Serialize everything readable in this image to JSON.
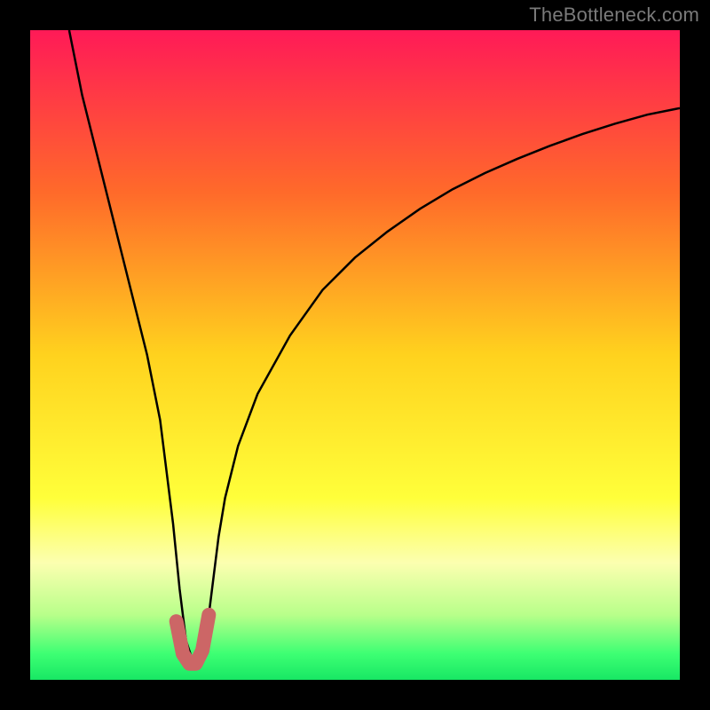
{
  "watermark": "TheBottleneck.com",
  "chart_data": {
    "type": "line",
    "title": "",
    "xlabel": "",
    "ylabel": "",
    "xlim": [
      0,
      100
    ],
    "ylim": [
      0,
      100
    ],
    "grid": false,
    "legend": false,
    "gradient": {
      "stops": [
        {
          "offset": 0.0,
          "color": "#ff1a57"
        },
        {
          "offset": 0.25,
          "color": "#ff6a2a"
        },
        {
          "offset": 0.5,
          "color": "#ffd21e"
        },
        {
          "offset": 0.72,
          "color": "#ffff3a"
        },
        {
          "offset": 0.82,
          "color": "#fcffb0"
        },
        {
          "offset": 0.9,
          "color": "#b8ff8a"
        },
        {
          "offset": 0.96,
          "color": "#3dff73"
        },
        {
          "offset": 1.0,
          "color": "#18e764"
        }
      ]
    },
    "series": [
      {
        "name": "bottleneck-curve",
        "stroke": "#000000",
        "x": [
          6,
          8,
          10,
          12,
          14,
          16,
          18,
          20,
          21,
          22,
          23,
          24,
          25,
          26,
          27,
          28,
          29,
          30,
          32,
          35,
          40,
          45,
          50,
          55,
          60,
          65,
          70,
          75,
          80,
          85,
          90,
          95,
          100
        ],
        "y": [
          100,
          90,
          82,
          74,
          66,
          58,
          50,
          40,
          32,
          24,
          14,
          6,
          3,
          3,
          6,
          14,
          22,
          28,
          36,
          44,
          53,
          60,
          65,
          69,
          72.5,
          75.5,
          78,
          80.2,
          82.2,
          84,
          85.6,
          87,
          88
        ]
      },
      {
        "name": "highlight-dip",
        "stroke": "#cc6666",
        "stroke_width": 16,
        "linecap": "round",
        "x": [
          22.5,
          23.5,
          24.5,
          25.5,
          26.5,
          27.5
        ],
        "y": [
          9,
          4,
          2.5,
          2.5,
          4.5,
          10
        ]
      }
    ],
    "annotations": []
  }
}
